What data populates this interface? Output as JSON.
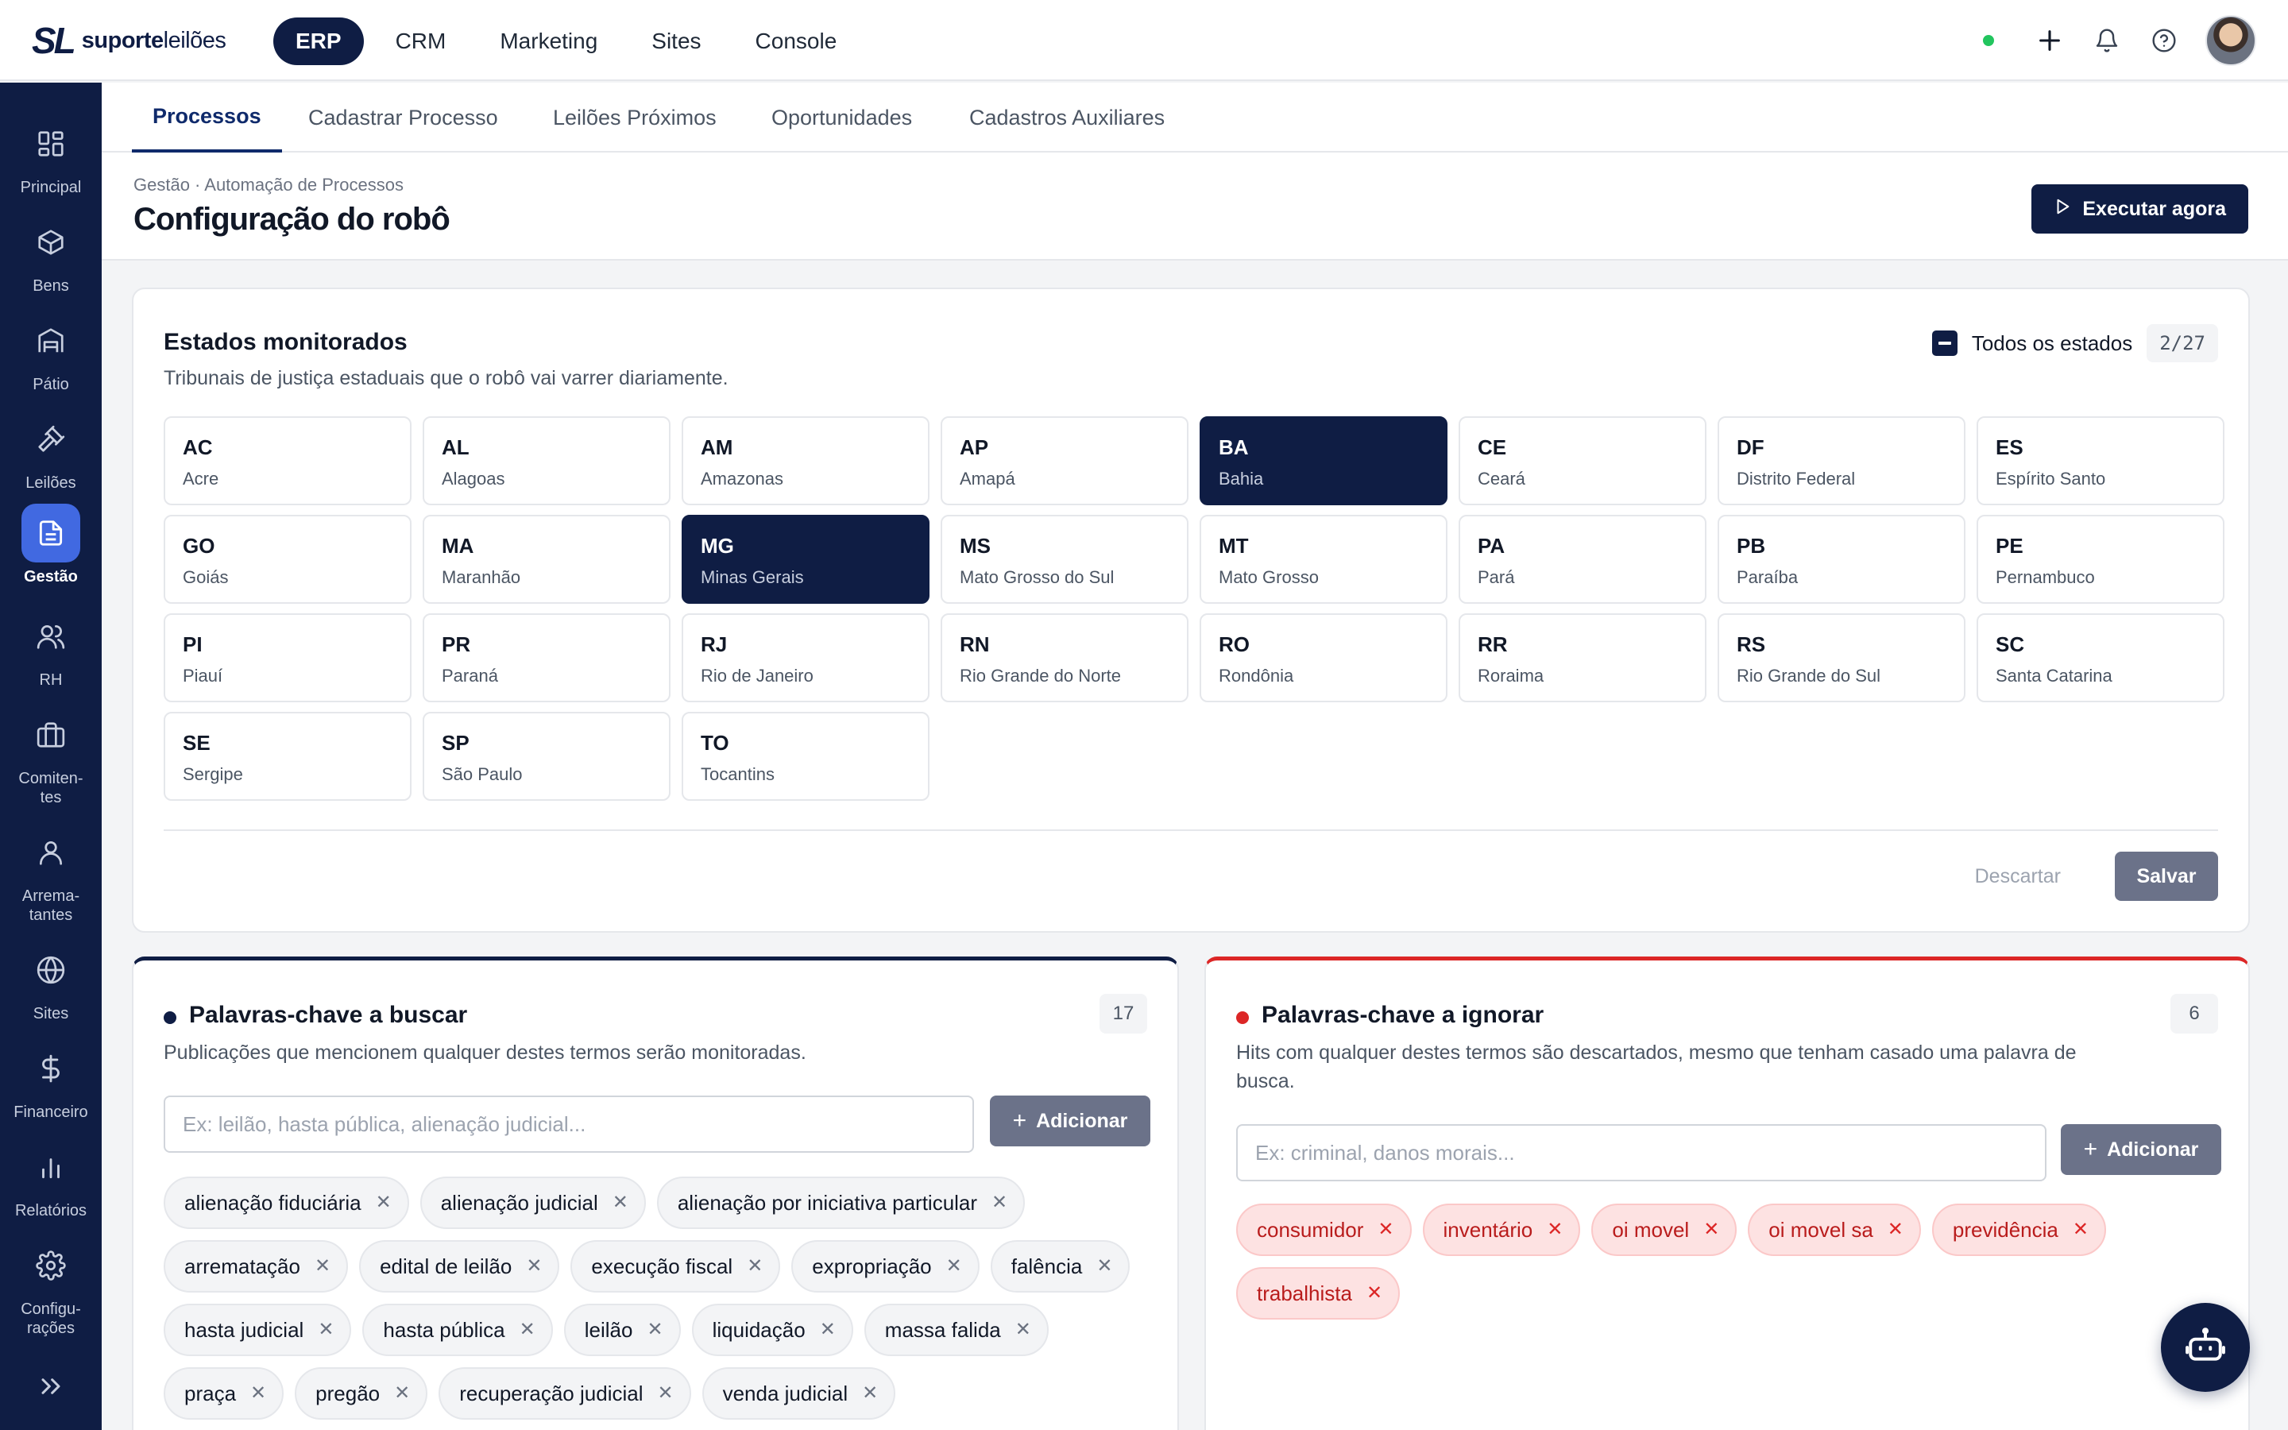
{
  "brand": {
    "mark": "SL",
    "name_bold": "suporte",
    "name_light": "leilões"
  },
  "main_nav": [
    {
      "label": "ERP",
      "active": true
    },
    {
      "label": "CRM",
      "active": false
    },
    {
      "label": "Marketing",
      "active": false
    },
    {
      "label": "Sites",
      "active": false
    },
    {
      "label": "Console",
      "active": false
    }
  ],
  "top_icons": [
    "plus-icon",
    "bell-icon",
    "help-icon"
  ],
  "sidebar": {
    "items": [
      {
        "label": "Principal",
        "icon": "grid-icon",
        "active": false
      },
      {
        "label": "Bens",
        "icon": "box-icon",
        "active": false
      },
      {
        "label": "Pátio",
        "icon": "warehouse-icon",
        "active": false
      },
      {
        "label": "Leilões",
        "icon": "gavel-icon",
        "active": false
      },
      {
        "label": "Gestão",
        "icon": "document-icon",
        "active": true
      },
      {
        "label": "RH",
        "icon": "users-icon",
        "active": false
      },
      {
        "label": "Comiten-\ntes",
        "icon": "briefcase-icon",
        "active": false
      },
      {
        "label": "Arrema-\ntantes",
        "icon": "user-icon",
        "active": false
      },
      {
        "label": "Sites",
        "icon": "globe-icon",
        "active": false
      },
      {
        "label": "Financeiro",
        "icon": "dollar-icon",
        "active": false
      },
      {
        "label": "Relatórios",
        "icon": "bar-chart-icon",
        "active": false
      },
      {
        "label": "Configu-\nrações",
        "icon": "gear-icon",
        "active": false
      }
    ],
    "expand_icon": "chevrons-right-icon"
  },
  "tabs": [
    {
      "label": "Processos",
      "active": true
    },
    {
      "label": "Cadastrar Processo",
      "active": false
    },
    {
      "label": "Leilões Próximos",
      "active": false
    },
    {
      "label": "Oportunidades",
      "active": false
    },
    {
      "label": "Cadastros Auxiliares",
      "active": false
    }
  ],
  "header": {
    "breadcrumb": "Gestão · Automação de Processos",
    "title": "Configuração do robô",
    "run_button": "Executar agora"
  },
  "states": {
    "title": "Estados monitorados",
    "subtitle": "Tribunais de justiça estaduais que o robô vai varrer diariamente.",
    "all_label": "Todos os estados",
    "count": "2/27",
    "items": [
      {
        "code": "AC",
        "name": "Acre",
        "selected": false
      },
      {
        "code": "AL",
        "name": "Alagoas",
        "selected": false
      },
      {
        "code": "AM",
        "name": "Amazonas",
        "selected": false
      },
      {
        "code": "AP",
        "name": "Amapá",
        "selected": false
      },
      {
        "code": "BA",
        "name": "Bahia",
        "selected": true
      },
      {
        "code": "CE",
        "name": "Ceará",
        "selected": false
      },
      {
        "code": "DF",
        "name": "Distrito Federal",
        "selected": false
      },
      {
        "code": "ES",
        "name": "Espírito Santo",
        "selected": false
      },
      {
        "code": "GO",
        "name": "Goiás",
        "selected": false
      },
      {
        "code": "MA",
        "name": "Maranhão",
        "selected": false
      },
      {
        "code": "MG",
        "name": "Minas Gerais",
        "selected": true
      },
      {
        "code": "MS",
        "name": "Mato Grosso do Sul",
        "selected": false
      },
      {
        "code": "MT",
        "name": "Mato Grosso",
        "selected": false
      },
      {
        "code": "PA",
        "name": "Pará",
        "selected": false
      },
      {
        "code": "PB",
        "name": "Paraíba",
        "selected": false
      },
      {
        "code": "PE",
        "name": "Pernambuco",
        "selected": false
      },
      {
        "code": "PI",
        "name": "Piauí",
        "selected": false
      },
      {
        "code": "PR",
        "name": "Paraná",
        "selected": false
      },
      {
        "code": "RJ",
        "name": "Rio de Janeiro",
        "selected": false
      },
      {
        "code": "RN",
        "name": "Rio Grande do Norte",
        "selected": false
      },
      {
        "code": "RO",
        "name": "Rondônia",
        "selected": false
      },
      {
        "code": "RR",
        "name": "Roraima",
        "selected": false
      },
      {
        "code": "RS",
        "name": "Rio Grande do Sul",
        "selected": false
      },
      {
        "code": "SC",
        "name": "Santa Catarina",
        "selected": false
      },
      {
        "code": "SE",
        "name": "Sergipe",
        "selected": false
      },
      {
        "code": "SP",
        "name": "São Paulo",
        "selected": false
      },
      {
        "code": "TO",
        "name": "Tocantins",
        "selected": false
      }
    ],
    "discard_label": "Descartar",
    "save_label": "Salvar"
  },
  "keywords_search": {
    "title": "Palavras-chave a buscar",
    "subtitle": "Publicações que mencionem qualquer destes termos serão monitoradas.",
    "count": "17",
    "placeholder": "Ex: leilão, hasta pública, alienação judicial...",
    "add_label": "Adicionar",
    "terms": [
      "alienação fiduciária",
      "alienação judicial",
      "alienação por iniciativa particular",
      "arrematação",
      "edital de leilão",
      "execução fiscal",
      "expropriação",
      "falência",
      "hasta judicial",
      "hasta pública",
      "leilão",
      "liquidação",
      "massa falida",
      "praça",
      "pregão",
      "recuperação judicial",
      "venda judicial"
    ]
  },
  "keywords_ignore": {
    "title": "Palavras-chave a ignorar",
    "subtitle": "Hits com qualquer destes termos são descartados, mesmo que tenham casado uma palavra de busca.",
    "count": "6",
    "placeholder": "Ex: criminal, danos morais...",
    "add_label": "Adicionar",
    "terms": [
      "consumidor",
      "inventário",
      "oi movel",
      "oi movel sa",
      "previdência",
      "trabalhista"
    ]
  },
  "colors": {
    "navy": "#0f1d44",
    "accent_blue": "#4169e1",
    "danger_red": "#dc2626",
    "online_green": "#22c55e"
  },
  "fab_icon": "robot-icon"
}
